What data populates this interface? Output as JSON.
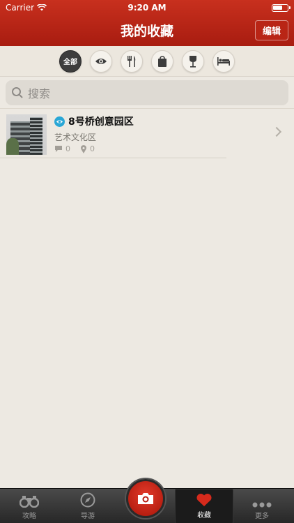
{
  "status": {
    "carrier": "Carrier",
    "time": "9:20 AM"
  },
  "header": {
    "title": "我的收藏",
    "edit_label": "编辑"
  },
  "filters": [
    {
      "name": "all",
      "label": "全部",
      "active": true
    },
    {
      "name": "sightseeing",
      "icon": "eye-icon"
    },
    {
      "name": "food",
      "icon": "fork-knife-icon"
    },
    {
      "name": "shopping",
      "icon": "bag-icon"
    },
    {
      "name": "nightlife",
      "icon": "wine-glass-icon"
    },
    {
      "name": "hotel",
      "icon": "bed-icon"
    }
  ],
  "search": {
    "placeholder": "搜索"
  },
  "favorites": [
    {
      "title": "8号桥创意园区",
      "category": "艺术文化区",
      "comments": "0",
      "checkins": "0",
      "type_icon": "eye-icon"
    }
  ],
  "tabs": [
    {
      "label": "攻略",
      "icon": "binoculars-icon"
    },
    {
      "label": "导游",
      "icon": "compass-icon"
    },
    {
      "label": "",
      "icon": "camera-icon"
    },
    {
      "label": "收藏",
      "icon": "heart-icon",
      "selected": true
    },
    {
      "label": "更多",
      "icon": "more-icon"
    }
  ],
  "colors": {
    "header": "#b92516",
    "accent_blue": "#2aa7d6",
    "background": "#ede9e2"
  }
}
